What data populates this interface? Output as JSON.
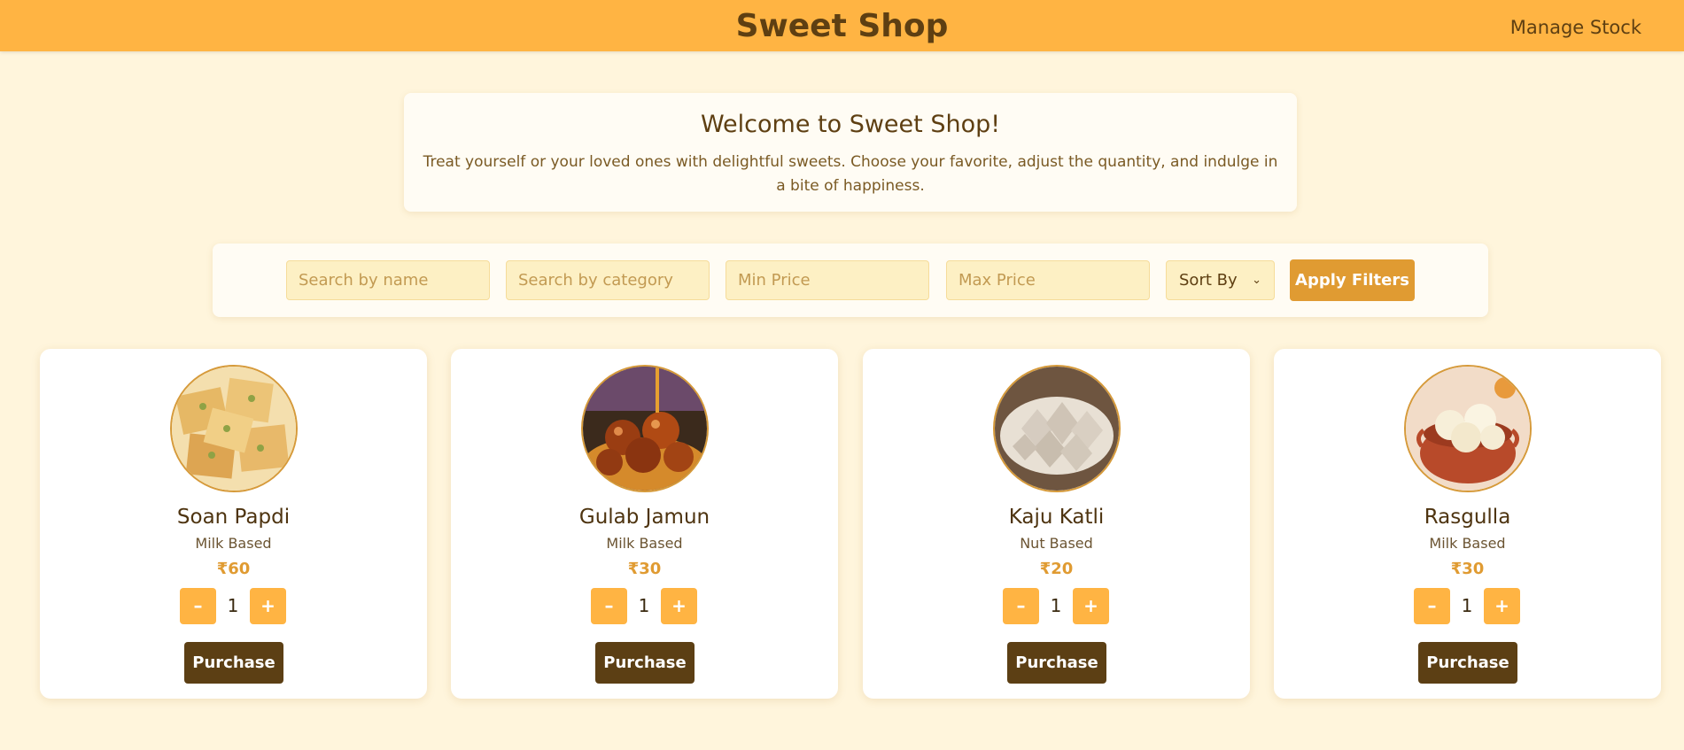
{
  "header": {
    "title": "Sweet Shop",
    "nav_link": "Manage Stock"
  },
  "welcome": {
    "title": "Welcome to Sweet Shop!",
    "text": "Treat yourself or your loved ones with delightful sweets. Choose your favorite, adjust the quantity, and indulge in a bite of happiness."
  },
  "filters": {
    "name_placeholder": "Search by name",
    "category_placeholder": "Search by category",
    "min_placeholder": "Min Price",
    "max_placeholder": "Max Price",
    "sort_label": "Sort By",
    "apply_label": "Apply Filters"
  },
  "products": [
    {
      "name": "Soan Papdi",
      "category": "Milk Based",
      "price": "₹60",
      "quantity": "1",
      "minus": "–",
      "plus": "+",
      "purchase": "Purchase"
    },
    {
      "name": "Gulab Jamun",
      "category": "Milk Based",
      "price": "₹30",
      "quantity": "1",
      "minus": "–",
      "plus": "+",
      "purchase": "Purchase"
    },
    {
      "name": "Kaju Katli",
      "category": "Nut Based",
      "price": "₹20",
      "quantity": "1",
      "minus": "–",
      "plus": "+",
      "purchase": "Purchase"
    },
    {
      "name": "Rasgulla",
      "category": "Milk Based",
      "price": "₹30",
      "quantity": "1",
      "minus": "–",
      "plus": "+",
      "purchase": "Purchase"
    }
  ],
  "colors": {
    "header_bg": "#ffb443",
    "page_bg": "#fff5dc",
    "accent": "#e09b32",
    "brown": "#5c3f14"
  }
}
